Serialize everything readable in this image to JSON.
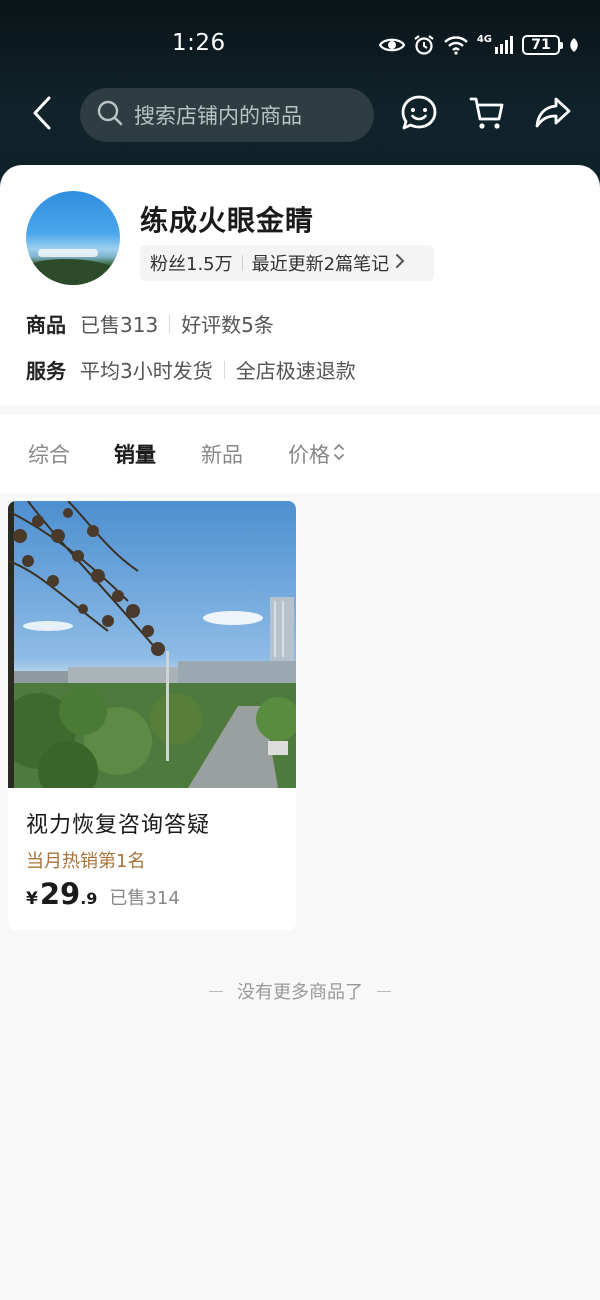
{
  "status_bar": {
    "time": "1:26",
    "network": "4G",
    "battery": "71"
  },
  "nav": {
    "search_placeholder": "搜索店铺内的商品"
  },
  "shop": {
    "name": "练成火眼金睛",
    "fans": "粉丝1.5万",
    "notes": "最近更新2篇笔记",
    "goods_label": "商品",
    "sold": "已售313",
    "reviews": "好评数5条",
    "service_label": "服务",
    "shipping": "平均3小时发货",
    "refund": "全店极速退款"
  },
  "sort_tabs": [
    {
      "label": "综合",
      "active": false
    },
    {
      "label": "销量",
      "active": true
    },
    {
      "label": "新品",
      "active": false
    },
    {
      "label": "价格",
      "active": false
    }
  ],
  "products": [
    {
      "title": "视力恢复咨询答疑",
      "rank": "当月热销第1名",
      "currency": "¥",
      "price_int": "29",
      "price_dec": ".9",
      "sold": "已售314"
    }
  ],
  "footer": {
    "end_text": "没有更多商品了"
  },
  "colors": {
    "header_bg": "#10232a",
    "rank_color": "#a8743a"
  },
  "icons": [
    "back-icon",
    "search-icon",
    "message-icon",
    "cart-icon",
    "share-icon",
    "chevron-right-icon",
    "sort-updown-icon"
  ]
}
